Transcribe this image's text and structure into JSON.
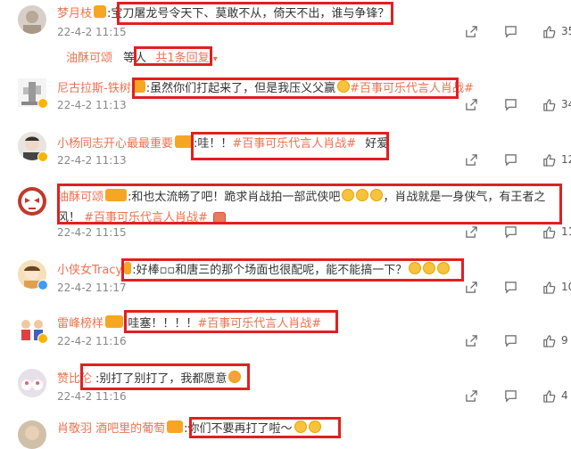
{
  "comments": [
    {
      "name": "梦月枝",
      "text": ":宝刀屠龙号令天下、莫敢不从，倚天不出，谁与争锋？",
      "tag": "",
      "date": "22-4-2 11:15",
      "likes": "35"
    },
    {
      "name": "尼古拉斯-铁树",
      "text": ":虽然你们打起来了，但是我压义父赢",
      "tag": "#百事可乐代言人肖战#",
      "date": "22-4-2 11:13",
      "likes": "34"
    },
    {
      "name": "小杨同志开心最最重要",
      "text": ":哇！！",
      "tag": "#百事可乐代言人肖战#",
      "tail": "好爱",
      "date": "22-4-2 11:13",
      "likes": "12"
    },
    {
      "name": "油酥可颂",
      "text": ":和也太流畅了吧！跪求肖战拍一部武侠吧",
      "text2": "，肖战就是一身侠气，有王者之",
      "line2": "风！",
      "tag": "#百事可乐代言人肖战#",
      "date": "22-4-2 11:15",
      "likes": "11"
    },
    {
      "name": "小侠女Tracy",
      "text": ":好棒▫▫和唐三的那个场面也很配呢，能不能搞一下？",
      "tag": "",
      "date": "22-4-2 11:17",
      "likes": "10"
    },
    {
      "name": "雷峰榜样",
      "text": ":哇塞！！！！",
      "tag": "#百事可乐代言人肖战#",
      "date": "22-4-2 11:16",
      "likes": "9"
    },
    {
      "name": "赞比伦",
      "text": ":别打了别打了，我都愿意",
      "tag": "",
      "date": "22-4-2 11:16",
      "likes": "4"
    },
    {
      "name": "肖敬羽 酒吧里的葡萄",
      "text": ":你们不要再打了啦～",
      "tag": "",
      "date": "",
      "likes": ""
    }
  ],
  "sub_reply": {
    "name": "油酥可颂",
    "text": "等人",
    "count": "共1条回复"
  },
  "icons": [
    "share-icon",
    "comment-icon",
    "like-icon"
  ],
  "colors": {
    "name": "#eb7350",
    "highlight": "#e02020",
    "text": "#333333",
    "meta": "#888888"
  }
}
